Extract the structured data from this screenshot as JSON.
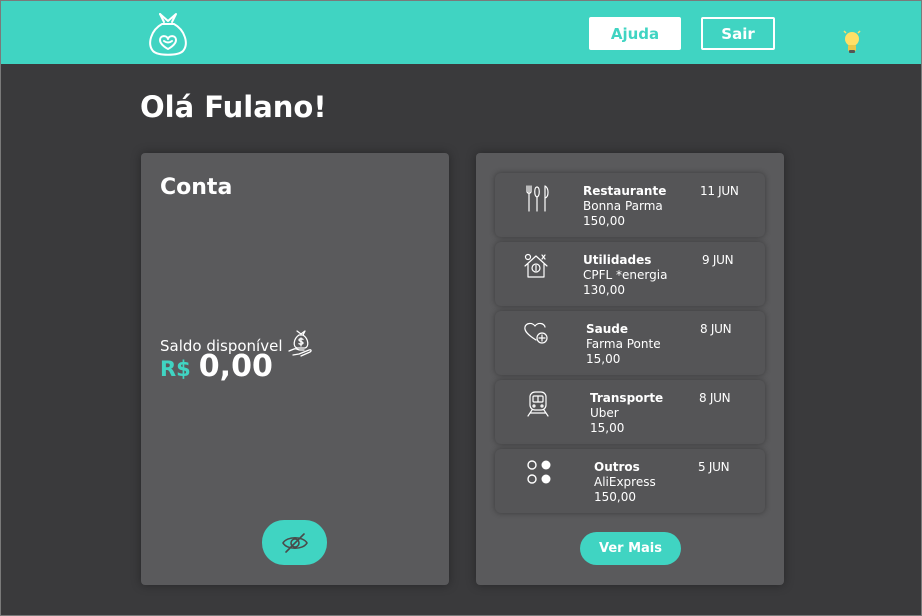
{
  "header": {
    "help_label": "Ajuda",
    "exit_label": "Sair"
  },
  "colors": {
    "accent": "#40d4c2",
    "background": "#3a3a3c",
    "card": "#5a5a5c"
  },
  "greeting": "Olá Fulano!",
  "account": {
    "title": "Conta",
    "balance_label": "Saldo disponível",
    "currency": "R$",
    "amount": "0,00"
  },
  "transactions": [
    {
      "icon": "cutlery-icon",
      "category": "Restaurante",
      "merchant": "Bonna Parma",
      "value": "150,00",
      "date": "11 JUN"
    },
    {
      "icon": "house-dollar-icon",
      "category": "Utilidades",
      "merchant": "CPFL *energia",
      "value": "130,00",
      "date": "9 JUN"
    },
    {
      "icon": "heart-plus-icon",
      "category": "Saude",
      "merchant": "Farma Ponte",
      "value": "15,00",
      "date": "8 JUN"
    },
    {
      "icon": "train-icon",
      "category": "Transporte",
      "merchant": "Uber",
      "value": "15,00",
      "date": "8 JUN"
    },
    {
      "icon": "dots-grid-icon",
      "category": "Outros",
      "merchant": "AliExpress",
      "value": "150,00",
      "date": "5 JUN"
    }
  ],
  "see_more_label": "Ver Mais"
}
